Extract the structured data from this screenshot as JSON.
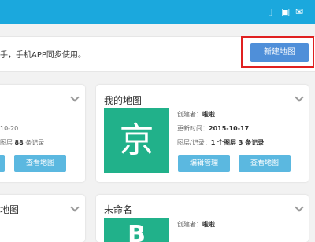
{
  "header": {
    "icons": [
      "phone-icon",
      "qr-icon",
      "mail-icon"
    ]
  },
  "notice": {
    "text": "手，手机APP同步使用。",
    "new_map_label": "新建地图"
  },
  "cards": {
    "left_top": {
      "date": "10-20",
      "layers_prefix": "图层",
      "layers_count": "88",
      "layers_suffix": "条记录",
      "view_label": "查看地图"
    },
    "my_map": {
      "title": "我的地图",
      "thumb_char": "京",
      "creator_label": "创建者：",
      "creator": "啦啦",
      "updated_label": "更新时间：",
      "updated": "2015-10-17",
      "layers_label": "图层/记录：",
      "layers_value": "1 个图层 3 条记录",
      "edit_label": "编辑管理",
      "view_label": "查看地图"
    },
    "left_bottom": {
      "title": "地图"
    },
    "unnamed": {
      "title": "未命名",
      "thumb_char": "B",
      "creator_label": "创建者：",
      "creator": "啦啦"
    }
  },
  "colors": {
    "topbar": "#1ba8dd",
    "primary_button": "#4f8fd9",
    "card_button": "#5bb8e0",
    "thumb": "#21b18a",
    "highlight": "#e02020"
  }
}
